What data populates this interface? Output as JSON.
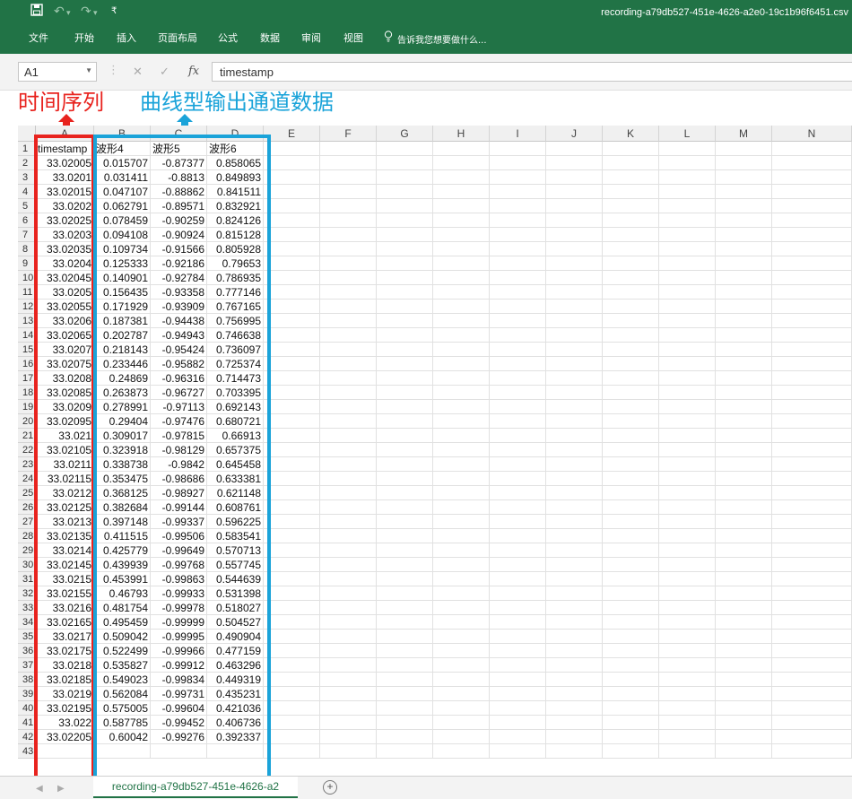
{
  "title_bar": {
    "document_title": "recording-a79db527-451e-4626-a2e0-19c1b96f6451.csv",
    "save_icon": "save-icon",
    "undo_icon": "undo-icon",
    "redo_icon": "redo-icon",
    "customize_icon": "customize-quick-access-icon"
  },
  "ribbon": {
    "tabs": [
      "文件",
      "开始",
      "插入",
      "页面布局",
      "公式",
      "数据",
      "审阅",
      "视图"
    ],
    "tell_me": "告诉我您想要做什么..."
  },
  "formula_bar": {
    "name_box": "A1",
    "formula_value": "timestamp",
    "fx_label": "fx"
  },
  "annotations": {
    "left_label": "时间序列",
    "right_label": "曲线型输出通道数据",
    "left_color": "#e8231e",
    "right_color": "#1aa3d9"
  },
  "grid": {
    "columns": [
      "A",
      "B",
      "C",
      "D",
      "E",
      "F",
      "G",
      "H",
      "I",
      "J",
      "K",
      "L",
      "M",
      "N"
    ],
    "header_row": [
      "timestamp",
      "波形4",
      "波形5",
      "波形6"
    ],
    "rows": [
      [
        "33.02005",
        "0.015707",
        "-0.87377",
        "0.858065"
      ],
      [
        "33.0201",
        "0.031411",
        "-0.8813",
        "0.849893"
      ],
      [
        "33.02015",
        "0.047107",
        "-0.88862",
        "0.841511"
      ],
      [
        "33.0202",
        "0.062791",
        "-0.89571",
        "0.832921"
      ],
      [
        "33.02025",
        "0.078459",
        "-0.90259",
        "0.824126"
      ],
      [
        "33.0203",
        "0.094108",
        "-0.90924",
        "0.815128"
      ],
      [
        "33.02035",
        "0.109734",
        "-0.91566",
        "0.805928"
      ],
      [
        "33.0204",
        "0.125333",
        "-0.92186",
        "0.79653"
      ],
      [
        "33.02045",
        "0.140901",
        "-0.92784",
        "0.786935"
      ],
      [
        "33.0205",
        "0.156435",
        "-0.93358",
        "0.777146"
      ],
      [
        "33.02055",
        "0.171929",
        "-0.93909",
        "0.767165"
      ],
      [
        "33.0206",
        "0.187381",
        "-0.94438",
        "0.756995"
      ],
      [
        "33.02065",
        "0.202787",
        "-0.94943",
        "0.746638"
      ],
      [
        "33.0207",
        "0.218143",
        "-0.95424",
        "0.736097"
      ],
      [
        "33.02075",
        "0.233446",
        "-0.95882",
        "0.725374"
      ],
      [
        "33.0208",
        "0.24869",
        "-0.96316",
        "0.714473"
      ],
      [
        "33.02085",
        "0.263873",
        "-0.96727",
        "0.703395"
      ],
      [
        "33.0209",
        "0.278991",
        "-0.97113",
        "0.692143"
      ],
      [
        "33.02095",
        "0.29404",
        "-0.97476",
        "0.680721"
      ],
      [
        "33.021",
        "0.309017",
        "-0.97815",
        "0.66913"
      ],
      [
        "33.02105",
        "0.323918",
        "-0.98129",
        "0.657375"
      ],
      [
        "33.0211",
        "0.338738",
        "-0.9842",
        "0.645458"
      ],
      [
        "33.02115",
        "0.353475",
        "-0.98686",
        "0.633381"
      ],
      [
        "33.0212",
        "0.368125",
        "-0.98927",
        "0.621148"
      ],
      [
        "33.02125",
        "0.382684",
        "-0.99144",
        "0.608761"
      ],
      [
        "33.0213",
        "0.397148",
        "-0.99337",
        "0.596225"
      ],
      [
        "33.02135",
        "0.411515",
        "-0.99506",
        "0.583541"
      ],
      [
        "33.0214",
        "0.425779",
        "-0.99649",
        "0.570713"
      ],
      [
        "33.02145",
        "0.439939",
        "-0.99768",
        "0.557745"
      ],
      [
        "33.0215",
        "0.453991",
        "-0.99863",
        "0.544639"
      ],
      [
        "33.02155",
        "0.46793",
        "-0.99933",
        "0.531398"
      ],
      [
        "33.0216",
        "0.481754",
        "-0.99978",
        "0.518027"
      ],
      [
        "33.02165",
        "0.495459",
        "-0.99999",
        "0.504527"
      ],
      [
        "33.0217",
        "0.509042",
        "-0.99995",
        "0.490904"
      ],
      [
        "33.02175",
        "0.522499",
        "-0.99966",
        "0.477159"
      ],
      [
        "33.0218",
        "0.535827",
        "-0.99912",
        "0.463296"
      ],
      [
        "33.02185",
        "0.549023",
        "-0.99834",
        "0.449319"
      ],
      [
        "33.0219",
        "0.562084",
        "-0.99731",
        "0.435231"
      ],
      [
        "33.02195",
        "0.575005",
        "-0.99604",
        "0.421036"
      ],
      [
        "33.022",
        "0.587785",
        "-0.99452",
        "0.406736"
      ],
      [
        "33.02205",
        "0.60042",
        "-0.99276",
        "0.392337"
      ]
    ]
  },
  "sheet_tabs": {
    "active": "recording-a79db527-451e-4626-a2"
  }
}
